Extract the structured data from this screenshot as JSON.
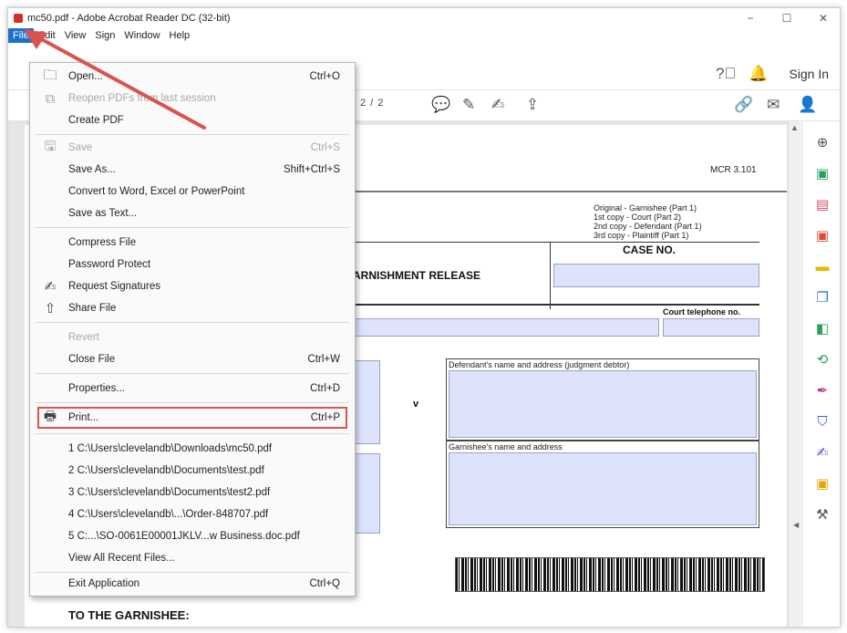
{
  "window": {
    "title": "mc50.pdf - Adobe Acrobat Reader DC (32-bit)",
    "minimize": "−",
    "maximize": "☐",
    "close": "✕"
  },
  "menubar": [
    "File",
    "Edit",
    "View",
    "Sign",
    "Window",
    "Help"
  ],
  "toolbar": {
    "sign_in": "Sign In",
    "page_indicator": "2  / 2"
  },
  "file_menu": [
    {
      "type": "item",
      "label": "Open...",
      "shortcut": "Ctrl+O",
      "icon": "folder-icon",
      "disabled": false
    },
    {
      "type": "item",
      "label": "Reopen PDFs from last session",
      "shortcut": "",
      "icon": "reopen-icon",
      "disabled": true
    },
    {
      "type": "item",
      "label": "Create PDF",
      "shortcut": "",
      "icon": "",
      "disabled": false
    },
    {
      "type": "item",
      "label": "Save",
      "shortcut": "Ctrl+S",
      "icon": "save-icon",
      "disabled": true
    },
    {
      "type": "item",
      "label": "Save As...",
      "shortcut": "Shift+Ctrl+S",
      "icon": "",
      "disabled": false
    },
    {
      "type": "item",
      "label": "Convert to Word, Excel or PowerPoint",
      "shortcut": "",
      "icon": "",
      "disabled": false
    },
    {
      "type": "item",
      "label": "Save as Text...",
      "shortcut": "",
      "icon": "",
      "disabled": false
    },
    {
      "type": "item",
      "label": "Compress File",
      "shortcut": "",
      "icon": "",
      "disabled": false
    },
    {
      "type": "item",
      "label": "Password Protect",
      "shortcut": "",
      "icon": "",
      "disabled": false
    },
    {
      "type": "item",
      "label": "Request Signatures",
      "shortcut": "",
      "icon": "request-signature-icon",
      "disabled": false
    },
    {
      "type": "item",
      "label": "Share File",
      "shortcut": "",
      "icon": "share-icon",
      "disabled": false
    },
    {
      "type": "item",
      "label": "Revert",
      "shortcut": "",
      "icon": "",
      "disabled": true
    },
    {
      "type": "item",
      "label": "Close File",
      "shortcut": "Ctrl+W",
      "icon": "",
      "disabled": false
    },
    {
      "type": "item",
      "label": "Properties...",
      "shortcut": "Ctrl+D",
      "icon": "",
      "disabled": false
    },
    {
      "type": "item",
      "label": "Print...",
      "shortcut": "Ctrl+P",
      "icon": "printer-icon",
      "disabled": false
    },
    {
      "type": "item",
      "label": "1 C:\\Users\\clevelandb\\Downloads\\mc50.pdf",
      "shortcut": "",
      "icon": "",
      "disabled": false
    },
    {
      "type": "item",
      "label": "2 C:\\Users\\clevelandb\\Documents\\test.pdf",
      "shortcut": "",
      "icon": "",
      "disabled": false
    },
    {
      "type": "item",
      "label": "3 C:\\Users\\clevelandb\\Documents\\test2.pdf",
      "shortcut": "",
      "icon": "",
      "disabled": false
    },
    {
      "type": "item",
      "label": "4 C:\\Users\\clevelandb\\...\\Order-848707.pdf",
      "shortcut": "",
      "icon": "",
      "disabled": false
    },
    {
      "type": "item",
      "label": "5 C:...\\SO-0061E00001JKLV...w Business.doc.pdf",
      "shortcut": "",
      "icon": "",
      "disabled": false
    },
    {
      "type": "item",
      "label": "View All Recent Files...",
      "shortcut": "",
      "icon": "",
      "disabled": false
    },
    {
      "type": "item",
      "label": "Exit Application",
      "shortcut": "Ctrl+Q",
      "icon": "",
      "disabled": false
    }
  ],
  "document": {
    "form_code": "MCR 3.101",
    "copies": [
      "Original - Garnishee (Part 1)",
      "1st copy - Court (Part 2)",
      "2nd copy - Defendant (Part 1)",
      "3rd copy - Plaintiff (Part 1)"
    ],
    "case_no": "CASE NO.",
    "title_fragment": "ARNISHMENT RELEASE",
    "court_phone": "Court telephone no.",
    "versus": "v",
    "defendant_label": "Defendant's name and address (judgment debtor)",
    "garnishee_label": "Garnishee's name and address",
    "to_garnishee": "TO THE GARNISHEE:"
  },
  "colors": {
    "menu_highlight": "#1a73c9",
    "annotation_red": "#d9534f",
    "field_fill": "#dde3fb"
  }
}
